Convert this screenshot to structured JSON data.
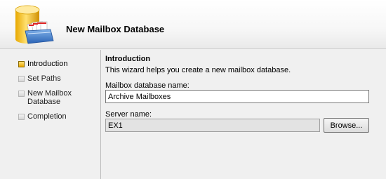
{
  "header": {
    "title": "New Mailbox Database",
    "icon": "mailbox-database-icon"
  },
  "steps": [
    {
      "label": "Introduction",
      "active": true
    },
    {
      "label": "Set Paths",
      "active": false
    },
    {
      "label": "New Mailbox Database",
      "active": false
    },
    {
      "label": "Completion",
      "active": false
    }
  ],
  "content": {
    "title": "Introduction",
    "description": "This wizard helps you create a new mailbox database.",
    "db_name_label": "Mailbox database name:",
    "db_name_value": "Archive Mailboxes",
    "server_label": "Server name:",
    "server_value": "EX1",
    "browse_label": "Browse..."
  },
  "colors": {
    "active_step": "#e9a600",
    "inactive_step": "#d5d5d5"
  }
}
